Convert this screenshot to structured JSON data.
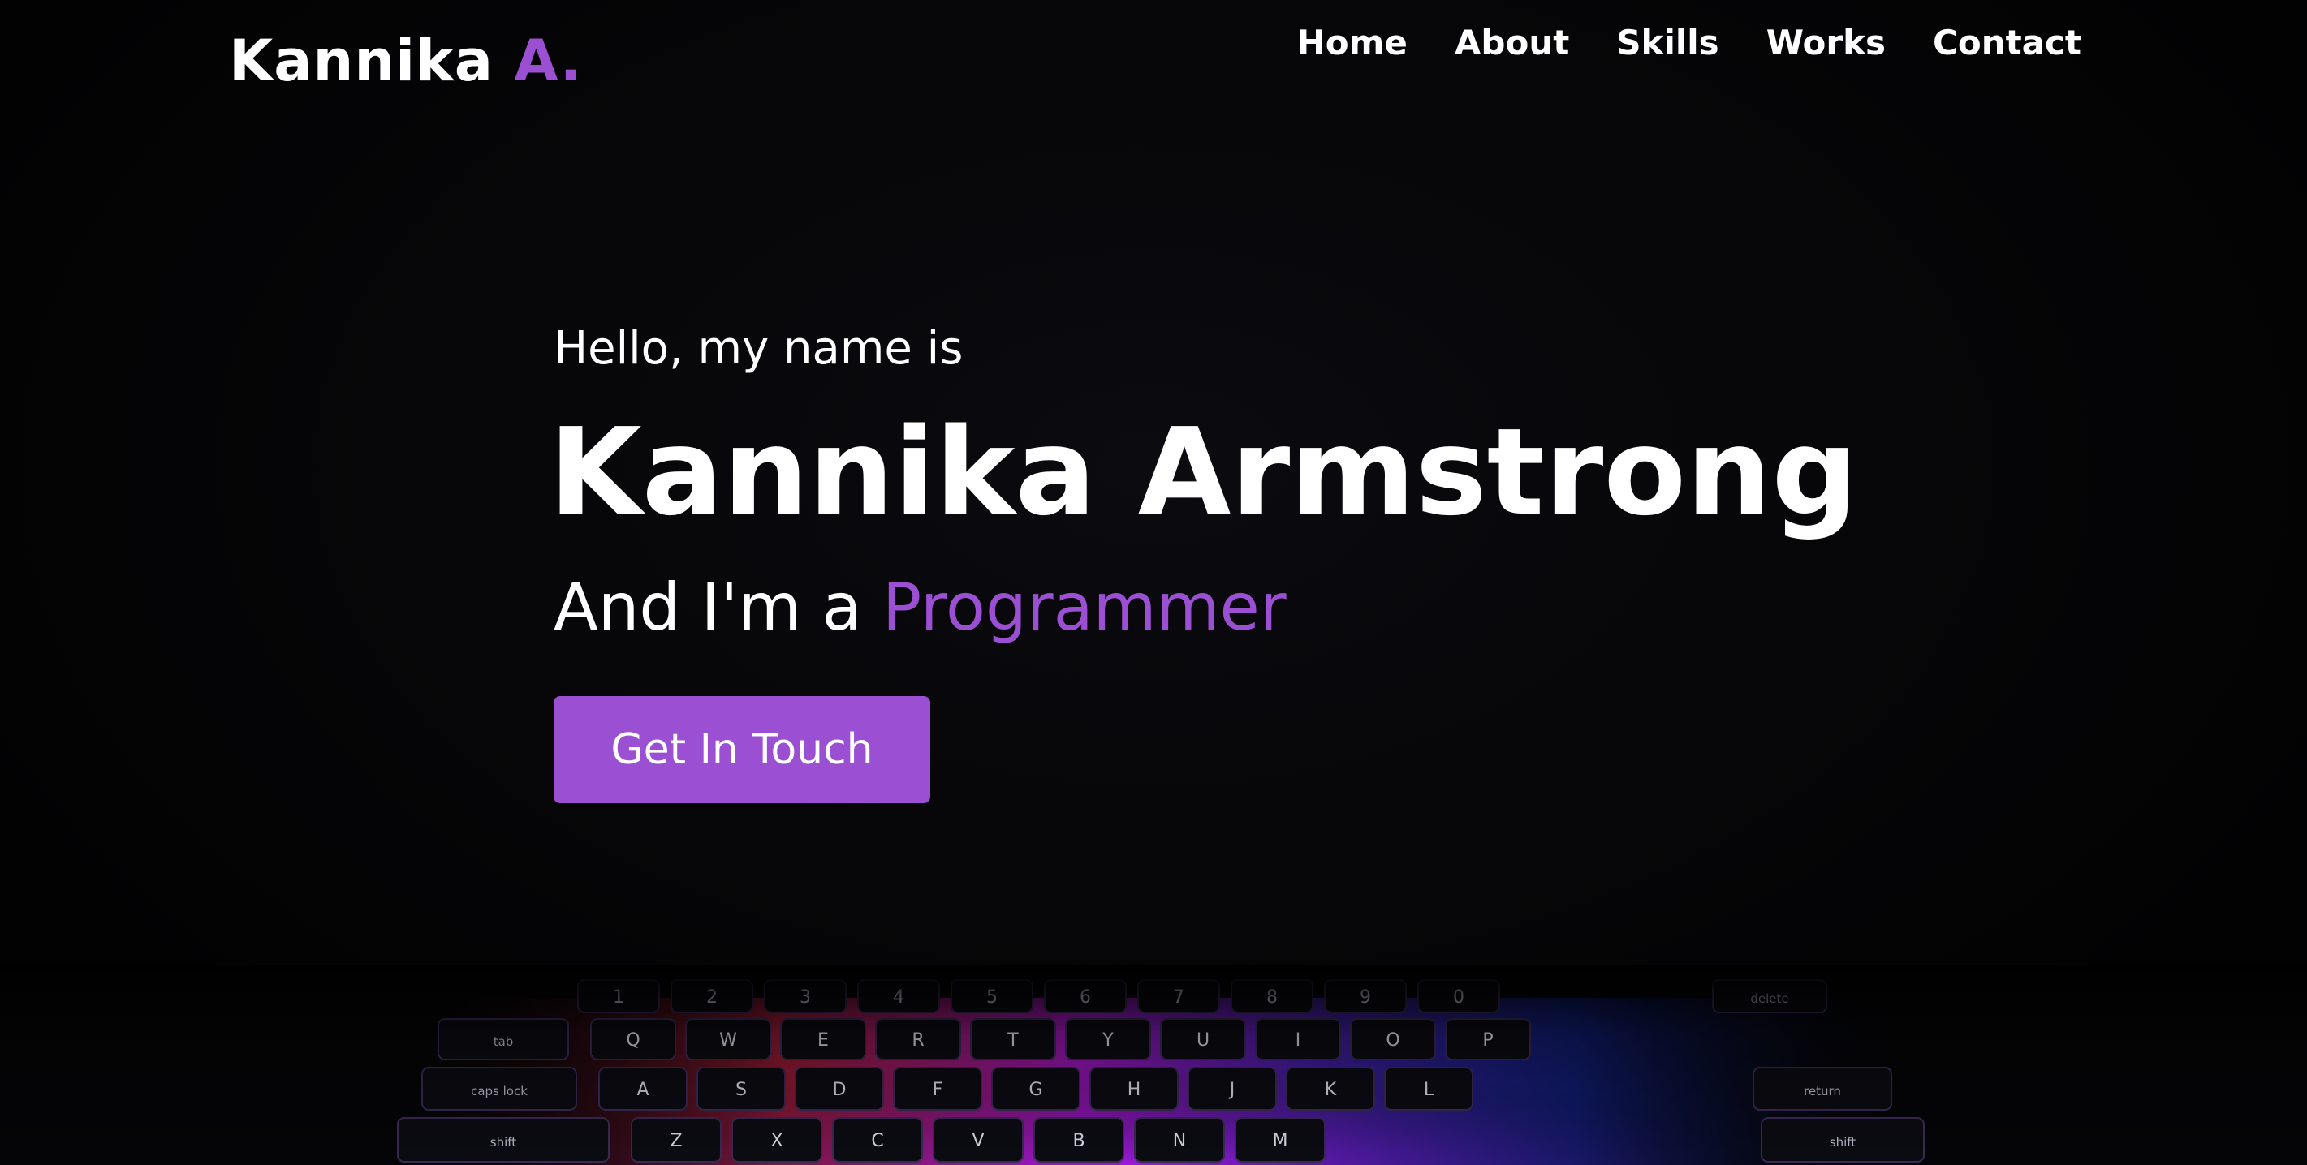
{
  "header": {
    "logo_text": "Kannika",
    "logo_accent": "A."
  },
  "nav": {
    "items": [
      {
        "label": "Home"
      },
      {
        "label": "About"
      },
      {
        "label": "Skills"
      },
      {
        "label": "Works"
      },
      {
        "label": "Contact"
      }
    ]
  },
  "hero": {
    "greeting": "Hello, my name is",
    "name": "Kannika Armstrong",
    "role_prefix": "And I'm a",
    "role": "Programmer",
    "cta_label": "Get In Touch"
  },
  "keyboard": {
    "number_row": [
      "1",
      "2",
      "3",
      "4",
      "5",
      "6",
      "7",
      "8",
      "9",
      "0"
    ],
    "top_row": [
      "Q",
      "W",
      "E",
      "R",
      "T",
      "Y",
      "U",
      "I",
      "O",
      "P"
    ],
    "home_row": [
      "A",
      "S",
      "D",
      "F",
      "G",
      "H",
      "J",
      "K",
      "L"
    ],
    "bottom_row": [
      "Z",
      "X",
      "C",
      "V",
      "B",
      "N",
      "M"
    ],
    "modifiers": {
      "tab": "tab",
      "caps": "caps lock",
      "shift_left": "shift",
      "delete": "delete",
      "return": "return",
      "shift_right": "shift"
    }
  },
  "colors": {
    "accent": "#9b4fd3",
    "background": "#000000",
    "text": "#ffffff"
  }
}
